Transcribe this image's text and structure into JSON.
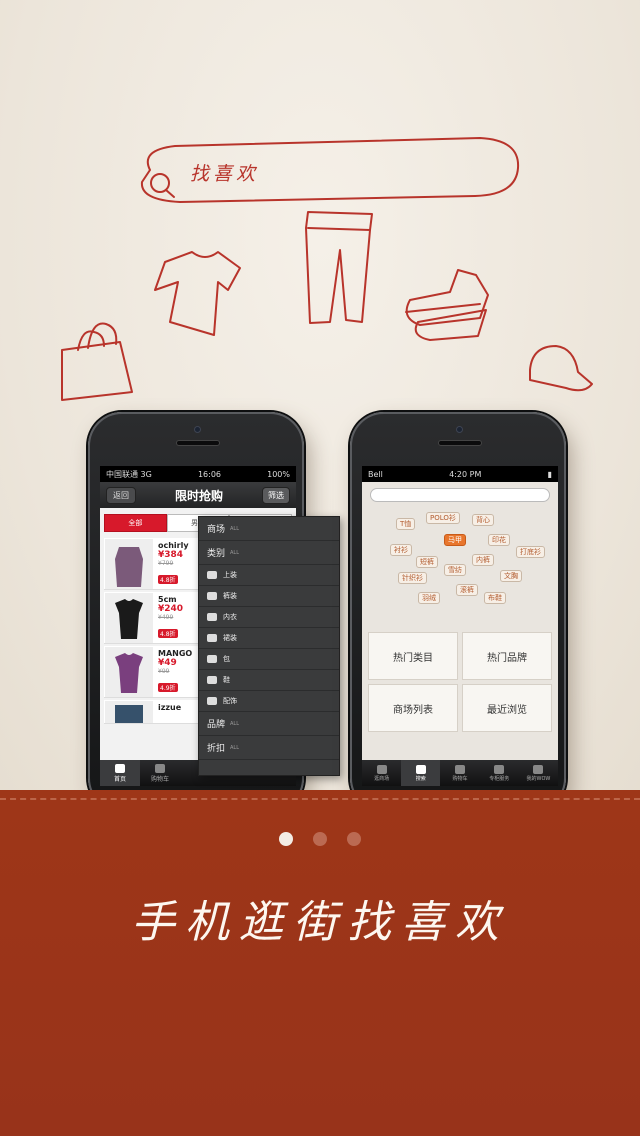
{
  "doodle": {
    "search_text": "找喜欢"
  },
  "left_phone": {
    "status": {
      "carrier": "中国联通",
      "network": "3G",
      "time": "16:06",
      "battery": "100%"
    },
    "nav": {
      "back": "返回",
      "title": "限时抢购",
      "filter": "筛选"
    },
    "segments": [
      {
        "label": "全部",
        "active": true
      },
      {
        "label": "男装",
        "active": false
      },
      {
        "label": "女装",
        "active": false
      }
    ],
    "items": [
      {
        "brand": "ochirly",
        "price": "¥384",
        "old_price": "¥799",
        "discount": "4.8折",
        "thumb_color": "#7b5a7a"
      },
      {
        "brand": "5cm",
        "price": "¥240",
        "old_price": "¥499",
        "discount": "4.8折",
        "thumb_color": "#1a1a1a"
      },
      {
        "brand": "MANGO",
        "price": "¥49",
        "old_price": "¥99",
        "discount": "4.9折",
        "thumb_color": "#7a3f7e"
      },
      {
        "brand": "izzue",
        "price": "",
        "old_price": "",
        "discount": "",
        "thumb_color": "#36516b"
      }
    ],
    "tabbar": [
      {
        "label": "首页",
        "active": true
      },
      {
        "label": "购物车",
        "active": false
      }
    ]
  },
  "filter_panel": {
    "all_label": "ALL",
    "sections": {
      "mall": "商场",
      "category": "类别",
      "brand": "品牌",
      "discount": "折扣"
    },
    "categories": [
      "上装",
      "裤装",
      "内衣",
      "裙装",
      "包",
      "鞋",
      "配饰"
    ]
  },
  "right_phone": {
    "status": {
      "carrier": "Bell",
      "time": "4:20 PM"
    },
    "tags": [
      "T恤",
      "POLO衫",
      "背心",
      "马甲",
      "印花",
      "衬衫",
      "短裤",
      "内裤",
      "打底衫",
      "雪纺",
      "针织衫",
      "文胸",
      "滚裤",
      "羽绒",
      "布鞋"
    ],
    "grid": [
      "热门类目",
      "热门品牌",
      "商场列表",
      "最近浏览"
    ],
    "tabbar": [
      {
        "label": "逛商场",
        "icon": "home-icon",
        "active": false
      },
      {
        "label": "搜索",
        "icon": "search-icon",
        "active": true
      },
      {
        "label": "购物车",
        "icon": "cart-icon",
        "active": false
      },
      {
        "label": "专柜服务",
        "icon": "bag-icon",
        "active": false
      },
      {
        "label": "我的WOW",
        "icon": "user-icon",
        "active": false
      }
    ]
  },
  "banner": {
    "slogan": "手机逛街找喜欢",
    "page_index": 1,
    "page_count": 3,
    "colors": {
      "banner": "#9e3618",
      "dot_active": "#f3ece4",
      "dot_inactive": "#bb6a52"
    }
  }
}
